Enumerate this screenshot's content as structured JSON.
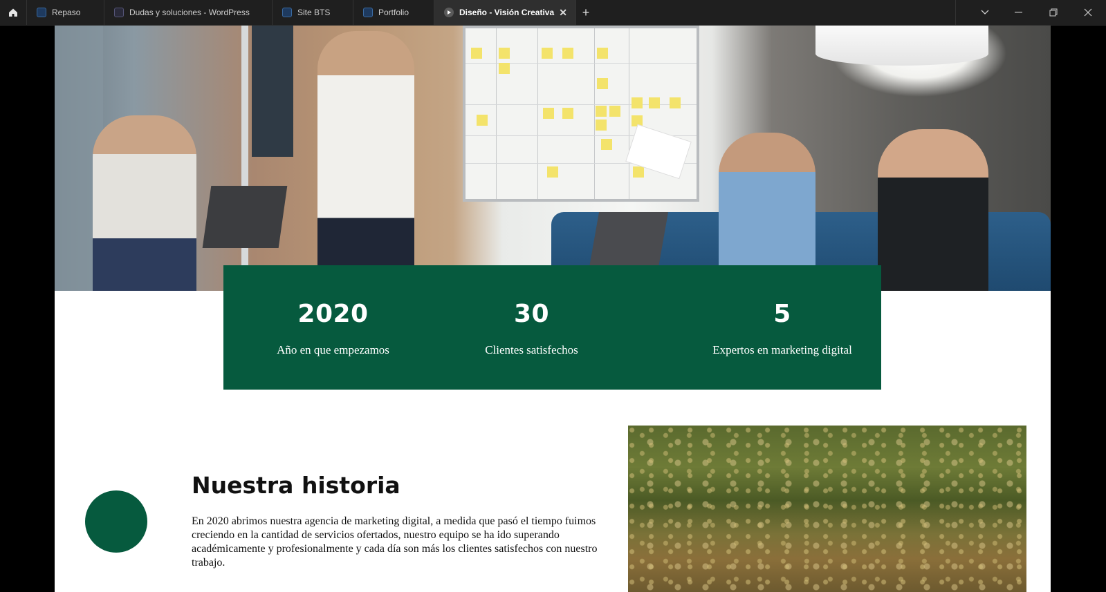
{
  "browser": {
    "tabs": [
      {
        "label": "Repaso",
        "active": false
      },
      {
        "label": "Dudas y soluciones - WordPress",
        "active": false
      },
      {
        "label": "Site BTS",
        "active": false
      },
      {
        "label": "Portfolio",
        "active": false
      },
      {
        "label": "Diseño - Visión Creativa",
        "active": true
      }
    ],
    "new_tab": "+",
    "close_tab": "✕"
  },
  "hero": {
    "image_icon": "team-meeting-photo"
  },
  "stats": [
    {
      "value": "2020",
      "label": "Año en que empezamos"
    },
    {
      "value": "30",
      "label": "Clientes satisfechos"
    },
    {
      "value": "5",
      "label": "Expertos en marketing digital"
    }
  ],
  "history": {
    "title": "Nuestra historia",
    "text": "En 2020 abrimos nuestra agencia de marketing digital, a medida que pasó el tiempo fuimos creciendo en la cantidad de servicios ofertados, nuestro equipo se ha ido superando académicamente y profesionalmente y cada día son más los clientes satisfechos con nuestro trabajo."
  },
  "colors": {
    "accent": "#065a3e",
    "tabbar": "#1f1f1f"
  }
}
